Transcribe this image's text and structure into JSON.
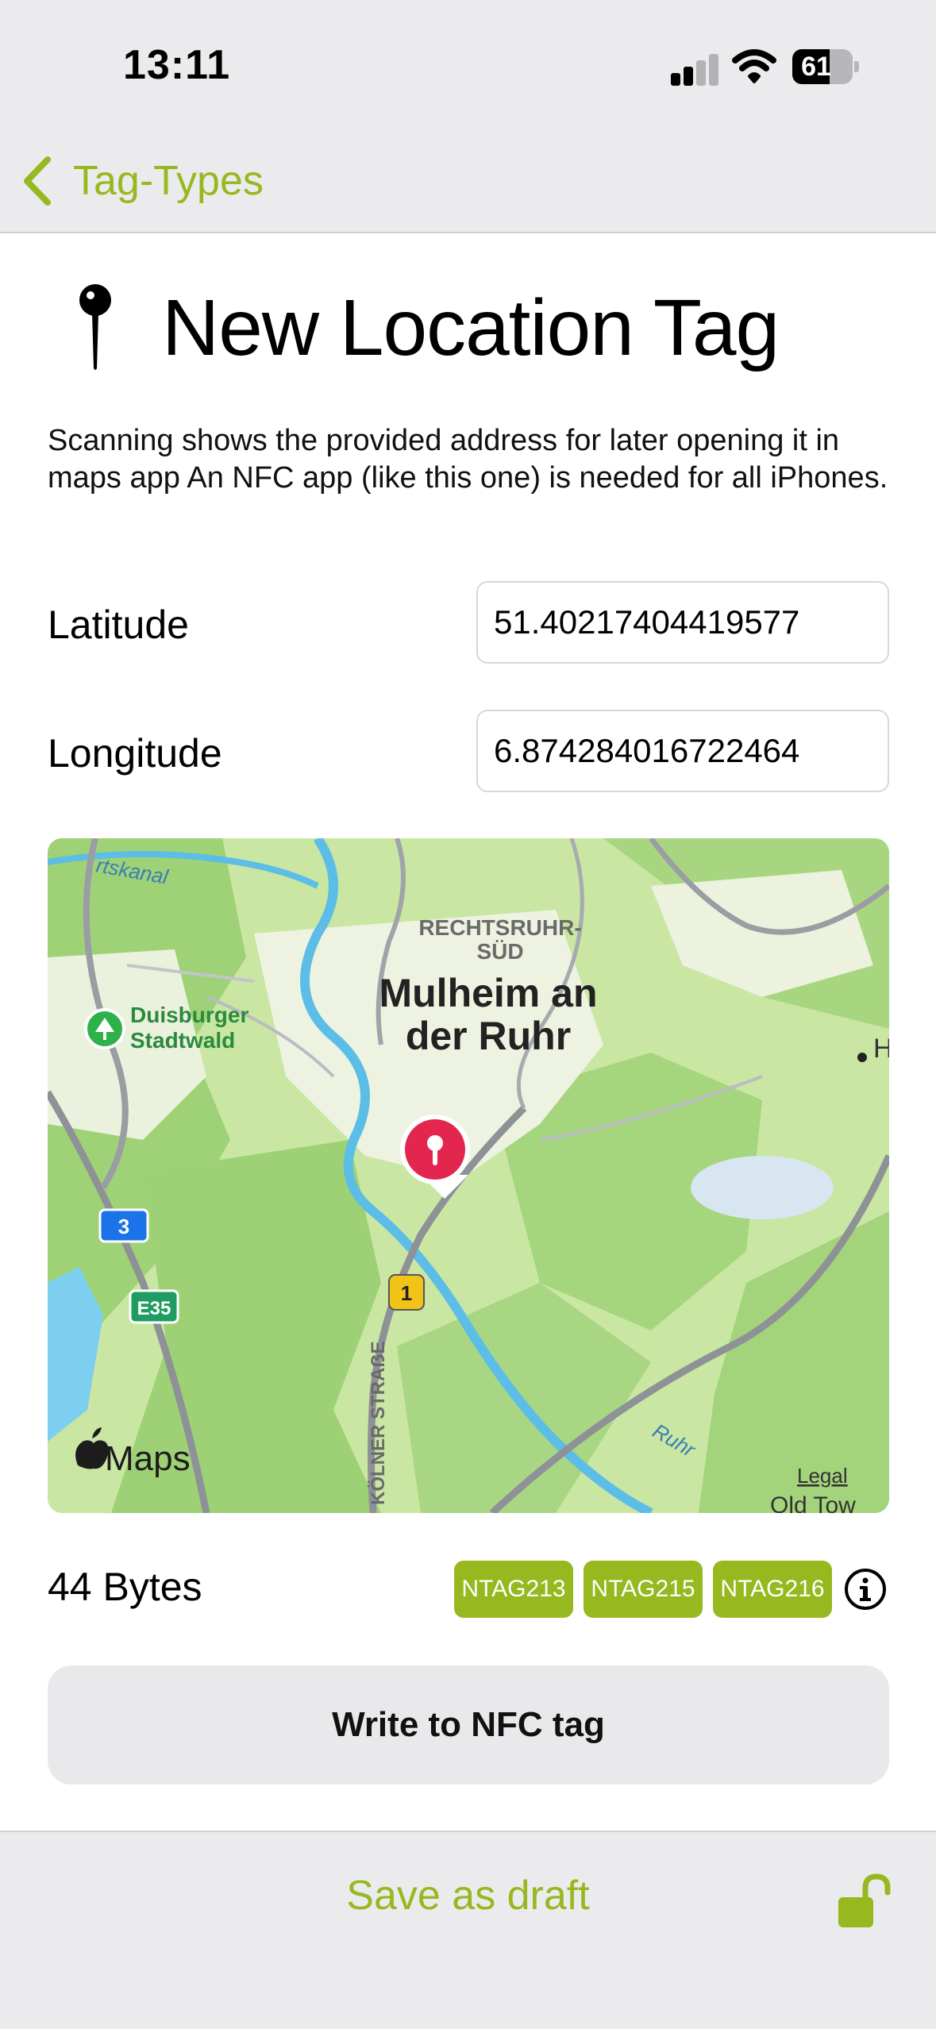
{
  "status_bar": {
    "time": "13:11",
    "battery_level": "61"
  },
  "nav": {
    "back_label": "Tag-Types",
    "accent_color": "#97b81f"
  },
  "header": {
    "title": "New Location Tag",
    "icon": "map-pin-icon",
    "description": "Scanning shows the provided address for later opening it in maps app An NFC app (like this one) is needed for all iPhones."
  },
  "fields": {
    "latitude_label": "Latitude",
    "latitude_value": "51.40217404419577",
    "longitude_label": "Longitude",
    "longitude_value": "6.874284016722464"
  },
  "map": {
    "labels": {
      "district": [
        "RECHTSRUHR-",
        "SÜD"
      ],
      "city": [
        "Mulheim an",
        "der Ruhr"
      ],
      "park": [
        "Duisburger",
        "Stadtwald"
      ],
      "street": "KÖLNER STRAẞE",
      "river": "Ruhr",
      "canal": "rtskanal",
      "edge_town": "Old Tow",
      "edge_letter": "H",
      "road_3": "3",
      "road_e35": "E35",
      "road_1": "1"
    },
    "brand": "Maps",
    "legal": "Legal"
  },
  "size": {
    "bytes_label": "44 Bytes",
    "chips": [
      "NTAG213",
      "NTAG215",
      "NTAG216"
    ]
  },
  "actions": {
    "write_label": "Write to NFC tag",
    "save_draft_label": "Save as draft"
  }
}
